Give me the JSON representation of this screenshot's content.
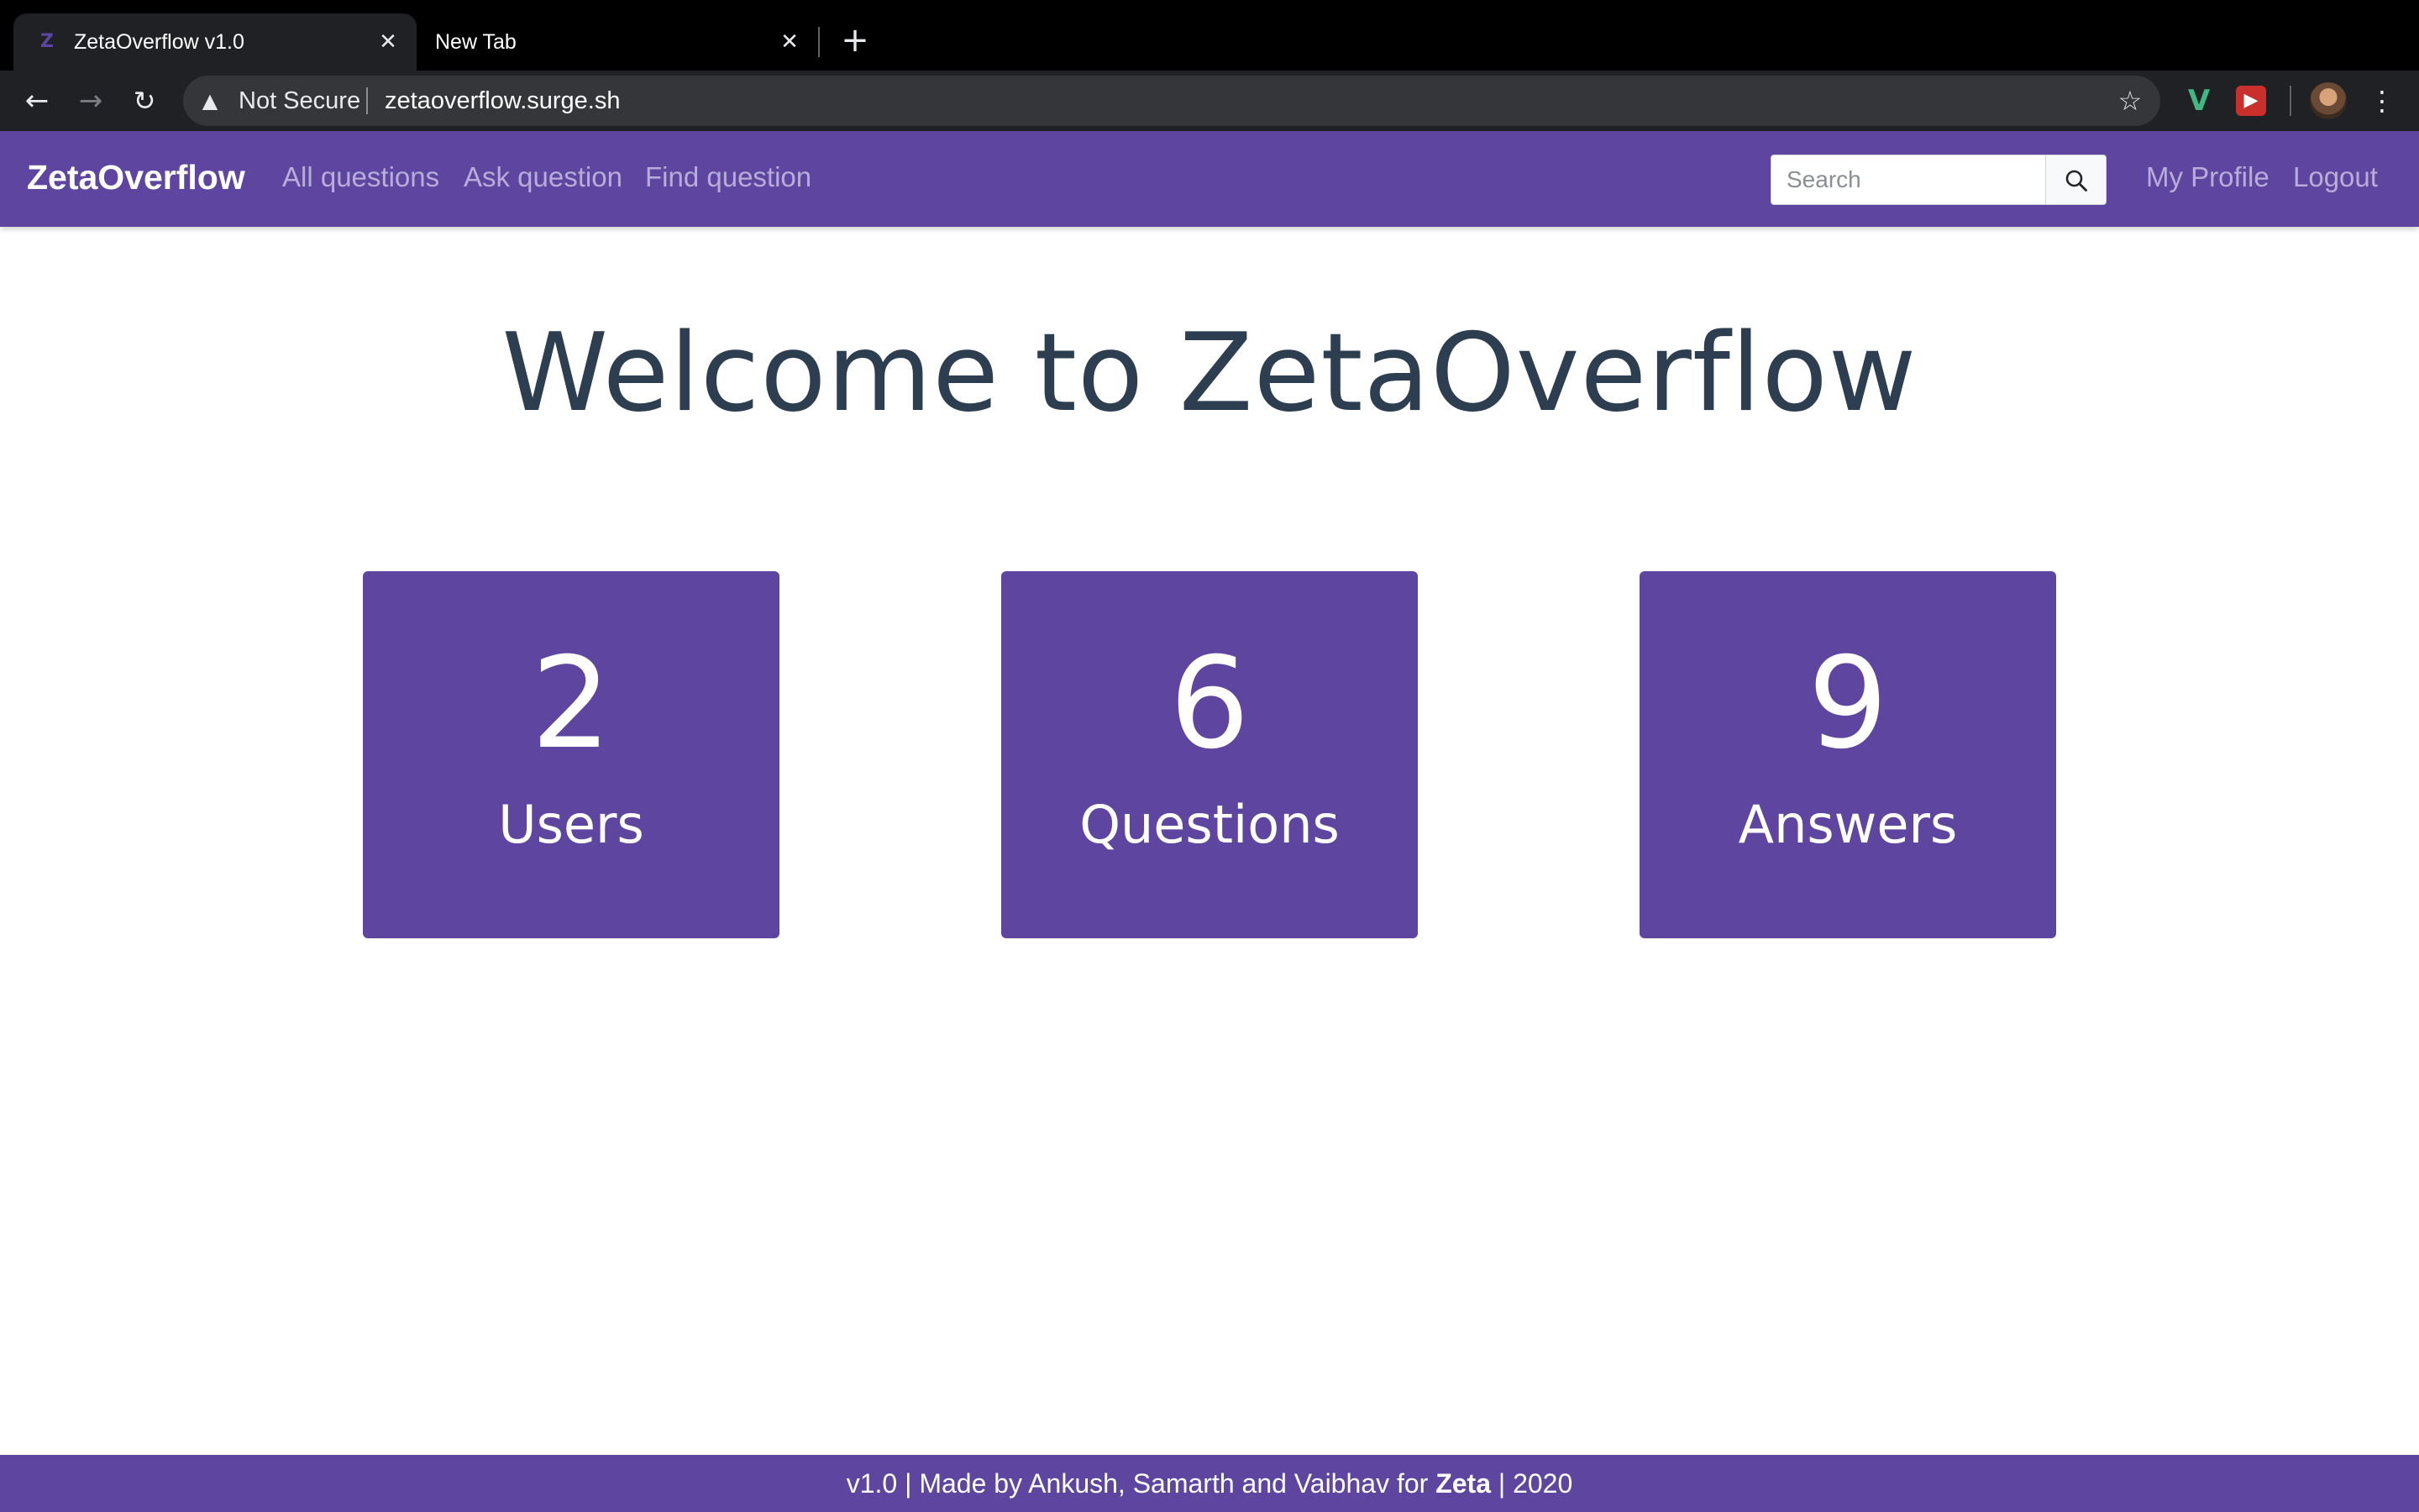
{
  "browser": {
    "tabs": [
      {
        "title": "ZetaOverflow v1.0",
        "favicon": "Z",
        "active": true
      },
      {
        "title": "New Tab",
        "active": false
      }
    ],
    "close_glyph": "✕",
    "new_tab_glyph": "+",
    "security_label": "Not Secure",
    "url": "zetaoverflow.surge.sh",
    "icons": {
      "back": "back-arrow-icon",
      "forward": "forward-arrow-icon",
      "reload": "reload-icon",
      "warning": "warning-icon",
      "bookmark": "bookmark-star-icon",
      "ext_vue": "vue-devtools-icon",
      "ext_red": "red-extension-icon",
      "avatar": "profile-avatar",
      "menu": "kebab-menu-icon"
    },
    "ext_vue_glyph": "V",
    "ext_red_glyph": "▶"
  },
  "navbar": {
    "brand": "ZetaOverflow",
    "links": [
      "All questions",
      "Ask question",
      "Find question"
    ],
    "search_placeholder": "Search",
    "search_value": "",
    "right_links": [
      "My Profile",
      "Logout"
    ]
  },
  "main": {
    "heading": "Welcome to ZetaOverflow",
    "stats": [
      {
        "value": "2",
        "label": "Users"
      },
      {
        "value": "6",
        "label": "Questions"
      },
      {
        "value": "9",
        "label": "Answers"
      }
    ]
  },
  "footer": {
    "prefix": "v1.0 | Made by Ankush, Samarth and Vaibhav for ",
    "emphasis": "Zeta",
    "suffix": " | 2020"
  },
  "colors": {
    "brand_purple": "#5e45a0",
    "heading": "#2c3e50",
    "nav_link": "#b8acd8",
    "chrome_dark": "#202124"
  }
}
